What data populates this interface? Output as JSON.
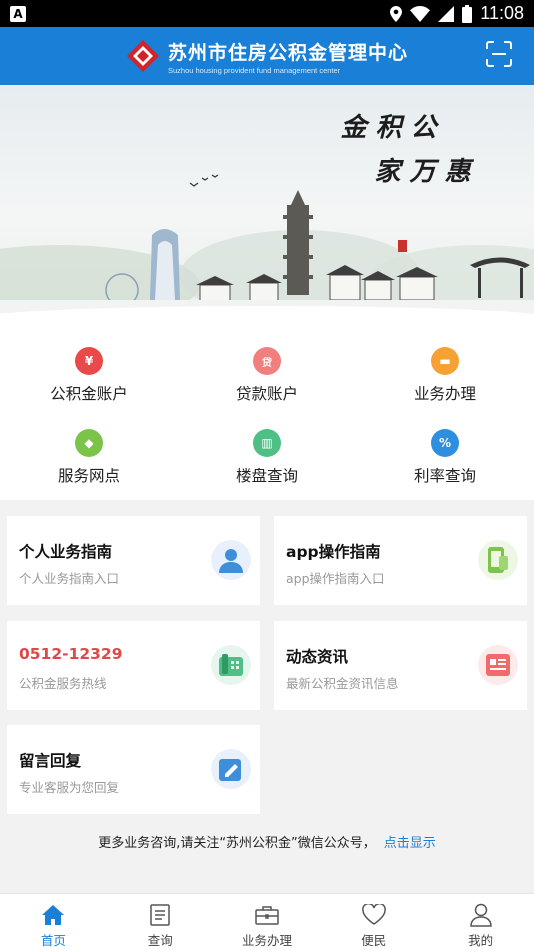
{
  "status_bar": {
    "app_badge": "A",
    "time": "11:08"
  },
  "header": {
    "title": "苏州市住房公积金管理中心",
    "subtitle": "Suzhou housing provident fund management center"
  },
  "banner": {
    "calligraphy_line1": "公积金",
    "calligraphy_line2": "惠万家"
  },
  "menu": [
    {
      "label": "公积金账户",
      "icon": "money-bag-icon",
      "color": "#e84a4a",
      "glyph": "¥"
    },
    {
      "label": "贷款账户",
      "icon": "loan-icon",
      "color": "#f27e7e",
      "glyph": "贷"
    },
    {
      "label": "业务办理",
      "icon": "briefcase-icon",
      "color": "#f5a232",
      "glyph": "▬"
    },
    {
      "label": "服务网点",
      "icon": "location-icon",
      "color": "#7cc34a",
      "glyph": "◆"
    },
    {
      "label": "楼盘查询",
      "icon": "building-icon",
      "color": "#4fbf86",
      "glyph": "▥"
    },
    {
      "label": "利率查询",
      "icon": "percent-icon",
      "color": "#2e8fe0",
      "glyph": "%"
    }
  ],
  "cards": [
    {
      "title": "个人业务指南",
      "subtitle": "个人业务指南入口",
      "icon": "person-icon",
      "icon_color": "#3d8fdc",
      "title_color": "#111111"
    },
    {
      "title": "app操作指南",
      "subtitle": "app操作指南入口",
      "icon": "phone-icon",
      "icon_color": "#7cc34a",
      "title_color": "#111111"
    },
    {
      "title": "0512-12329",
      "subtitle": "公积金服务热线",
      "icon": "telephone-icon",
      "icon_color": "#4fbf86",
      "title_color": "#e04848"
    },
    {
      "title": "动态资讯",
      "subtitle": "最新公积金资讯信息",
      "icon": "news-icon",
      "icon_color": "#f26b6b",
      "title_color": "#111111"
    },
    {
      "title": "留言回复",
      "subtitle": "专业客服为您回复",
      "icon": "edit-icon",
      "icon_color": "#3d8fdc",
      "title_color": "#111111"
    }
  ],
  "notice": {
    "text": "更多业务咨询,请关注“苏州公积金”微信公众号，",
    "link": "点击显示"
  },
  "tabs": [
    {
      "label": "首页",
      "icon": "home-icon",
      "active": true
    },
    {
      "label": "查询",
      "icon": "document-icon",
      "active": false
    },
    {
      "label": "业务办理",
      "icon": "briefcase-icon",
      "active": false
    },
    {
      "label": "便民",
      "icon": "heart-icon",
      "active": false
    },
    {
      "label": "我的",
      "icon": "user-icon",
      "active": false
    }
  ],
  "colors": {
    "brand": "#1a7fd6",
    "accent_red": "#e04848"
  }
}
